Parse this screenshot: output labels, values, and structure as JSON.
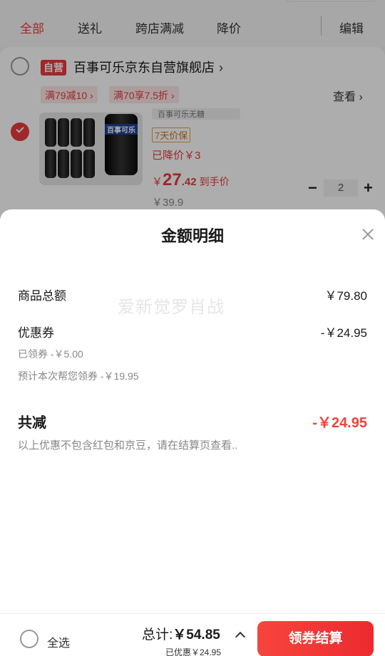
{
  "tabs": [
    {
      "label": "全部",
      "active": true
    },
    {
      "label": "送礼",
      "active": false
    },
    {
      "label": "跨店满减",
      "active": false
    },
    {
      "label": "降价",
      "active": false
    }
  ],
  "edit_label": "编辑",
  "shop": {
    "badge": "自营",
    "name": "百事可乐京东自营旗舰店",
    "promos": [
      "满79减10 ›",
      "满70享7.5折 ›"
    ],
    "view_link": "查看 ›"
  },
  "product": {
    "checked": true,
    "image_logo": "百事可乐",
    "spec": "百事可乐无糖",
    "warranty": "7天价保",
    "price_drop": "已降价￥3",
    "price_yen": "￥",
    "price_int": "27",
    "price_dec": ".42",
    "price_tag": "到手价",
    "price_original": "￥39.9",
    "quantity": "2",
    "minus": "−",
    "plus": "+"
  },
  "sheet": {
    "title": "金额明细",
    "watermark": "爱新觉罗肖战",
    "rows": {
      "goods_total_label": "商品总额",
      "goods_total_value": "￥79.80",
      "coupon_label": "优惠券",
      "coupon_value": "-￥24.95",
      "claimed_coupon": "已领券 -￥5.00",
      "estimated_coupon": "预计本次帮您领券 -￥19.95"
    },
    "total_label": "共减",
    "total_value": "-￥24.95",
    "note": "以上优惠不包含红包和京豆，请在结算页查看.."
  },
  "bottom": {
    "select_all": "全选",
    "total_prefix": "总计:",
    "total_amount": "￥54.85",
    "saved": "已优惠￥24.95",
    "checkout": "领券结算"
  },
  "colors": {
    "accent": "#e93b3d",
    "discount": "#f0443a"
  }
}
